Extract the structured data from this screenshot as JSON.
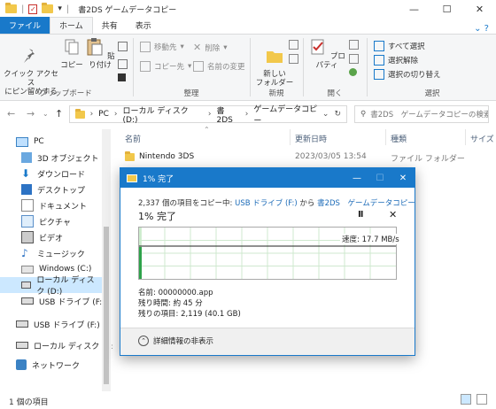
{
  "window": {
    "title": "書2DS ゲームデータコピー",
    "min": "—",
    "max": "☐",
    "close": "✕"
  },
  "ribbon_tabs": [
    "ファイル",
    "ホーム",
    "共有",
    "表示"
  ],
  "ribbon": {
    "clipboard": {
      "pin": "クイック アクセス\nにピン留めする",
      "copy": "コピー",
      "paste": "貼り付け",
      "label": "クリップボード"
    },
    "organize": {
      "move": "移動先",
      "copy_to": "コピー先",
      "delete": "削除",
      "rename": "名前の変更",
      "label": "整理"
    },
    "new": {
      "new_folder": "新しい\nフォルダー",
      "label": "新規"
    },
    "open": {
      "properties": "プロパティ",
      "label": "開く"
    },
    "select": {
      "select_all": "すべて選択",
      "select_none": "選択解除",
      "invert": "選択の切り替え",
      "label": "選択"
    }
  },
  "address": {
    "crumbs": [
      "PC",
      "ローカル ディスク (D:)",
      "書2DS",
      "ゲームデータコピー"
    ],
    "search_placeholder": "書2DS　ゲームデータコピーの検索"
  },
  "nav": [
    {
      "label": "PC",
      "icon": "pc-icon"
    },
    {
      "label": "3D オブジェクト",
      "icon": "3d-objects-icon"
    },
    {
      "label": "ダウンロード",
      "icon": "download-icon"
    },
    {
      "label": "デスクトップ",
      "icon": "desktop-icon"
    },
    {
      "label": "ドキュメント",
      "icon": "document-icon"
    },
    {
      "label": "ピクチャ",
      "icon": "pictures-icon"
    },
    {
      "label": "ビデオ",
      "icon": "video-icon"
    },
    {
      "label": "ミュージック",
      "icon": "music-icon"
    },
    {
      "label": "Windows (C:)",
      "icon": "drive-c-icon"
    },
    {
      "label": "ローカル ディスク (D:)",
      "icon": "drive-d-icon"
    },
    {
      "label": "USB ドライブ (F:)",
      "icon": "usb-drive-icon"
    },
    {
      "label": "USB ドライブ (F:)",
      "icon": "usb-drive-icon"
    },
    {
      "label": "ローカル ディスク (D:)",
      "icon": "drive-d-icon"
    },
    {
      "label": "ネットワーク",
      "icon": "network-icon"
    }
  ],
  "columns": {
    "name": "名前",
    "date": "更新日時",
    "type": "種類",
    "size": "サイズ"
  },
  "files": [
    {
      "name": "Nintendo 3DS",
      "date": "2023/03/05 13:54",
      "type": "ファイル フォルダー"
    }
  ],
  "status": {
    "count": "1 個の項目"
  },
  "dialog": {
    "title": "1% 完了",
    "line_prefix": "2,337 個の項目をコピー中: ",
    "source": "USB ドライブ (F:)",
    "mid": " から ",
    "dest": "書2DS　ゲームデータコピー",
    "big": "1% 完了",
    "pause": "II",
    "close": "✕",
    "speed": "速度: 17.7 MB/s",
    "progress_fraction": 0.01,
    "name_label": "名前: 00000000.app",
    "remaining_time": "残り時間: 約 45 分",
    "remaining_items": "残りの項目: 2,119 (40.1 GB)",
    "details_toggle": "詳細情報の非表示"
  }
}
